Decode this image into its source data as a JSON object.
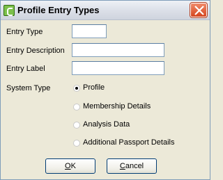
{
  "window": {
    "title": "Profile Entry Types"
  },
  "form": {
    "entry_type_label": "Entry Type",
    "entry_type_value": "",
    "entry_description_label": "Entry Description",
    "entry_description_value": "",
    "entry_label_label": "Entry Label",
    "entry_label_value": "",
    "system_type_label": "System Type",
    "system_type_options": [
      {
        "label": "Profile",
        "checked": true
      },
      {
        "label": "Membership Details",
        "checked": false
      },
      {
        "label": "Analysis Data",
        "checked": false
      },
      {
        "label": "Additional Passport Details",
        "checked": false
      }
    ]
  },
  "buttons": {
    "ok_first": "O",
    "ok_rest": "K",
    "cancel_first": "C",
    "cancel_rest": "ancel"
  }
}
